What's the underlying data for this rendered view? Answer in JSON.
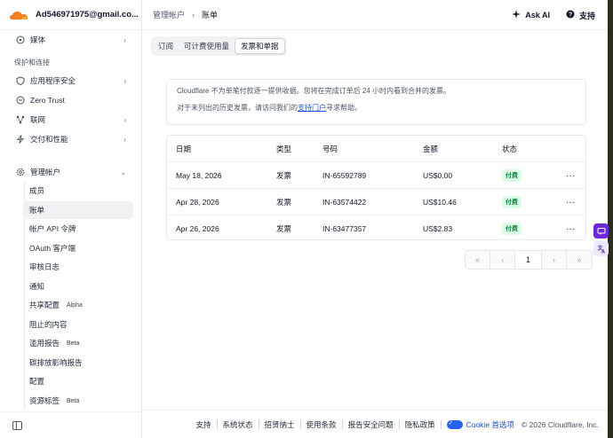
{
  "account": {
    "email": "Ad546971975@gmail.co..."
  },
  "sidebar": {
    "media_label": "媒体",
    "section_protect": "保护和连接",
    "items": [
      {
        "label": "应用程序安全",
        "icon": "shield-icon"
      },
      {
        "label": "Zero Trust",
        "icon": "zero-trust-icon"
      },
      {
        "label": "联网",
        "icon": "network-icon"
      },
      {
        "label": "交付和性能",
        "icon": "bolt-icon"
      }
    ],
    "manage_account": "管理帐户",
    "sub_items": [
      {
        "label": "成员"
      },
      {
        "label": "账单"
      },
      {
        "label": "帐户 API 令牌"
      },
      {
        "label": "OAuth 客户端"
      },
      {
        "label": "审核日志"
      },
      {
        "label": "通知"
      },
      {
        "label": "共享配置",
        "tag": "Alpha"
      },
      {
        "label": "阻止的内容"
      },
      {
        "label": "滥用报告",
        "tag": "Beta"
      },
      {
        "label": "碳排放影响报告"
      },
      {
        "label": "配置"
      },
      {
        "label": "资源标签",
        "tag": "Beta"
      }
    ]
  },
  "breadcrumb": {
    "parent": "管理帐户",
    "current": "账单"
  },
  "top_actions": {
    "ask_ai": "Ask AI",
    "support": "支持"
  },
  "tabs": [
    "订阅",
    "可计费使用量",
    "发票和单据"
  ],
  "notice": {
    "line1": "Cloudflare 不为单笔付款逐一提供收据。您将在完成订单后 24 小时内看到合并的发票。",
    "line2_prefix": "对于未列出的历史发票，请访问我们的",
    "line2_link": "支持门户",
    "line2_suffix": "寻求帮助。"
  },
  "table": {
    "headers": [
      "日期",
      "类型",
      "号码",
      "金额",
      "状态"
    ],
    "rows": [
      {
        "date": "May 18, 2026",
        "type": "发票",
        "number": "IN-65592789",
        "amount": "US$0.00",
        "status": "付费"
      },
      {
        "date": "Apr 28, 2026",
        "type": "发票",
        "number": "IN-63574422",
        "amount": "US$10.46",
        "status": "付费"
      },
      {
        "date": "Apr 26, 2026",
        "type": "发票",
        "number": "IN-63477357",
        "amount": "US$2.83",
        "status": "付费"
      }
    ],
    "more_label": "···"
  },
  "pagination": {
    "current_page": "1",
    "first": "«",
    "prev": "‹",
    "next": "›",
    "last": "»"
  },
  "footer": {
    "links": [
      "支持",
      "系统状态",
      "招贤纳士",
      "使用条款",
      "报告安全问题",
      "隐私政策"
    ],
    "cookie": "Cookie 首选项",
    "copyright": "© 2026 Cloudflare, Inc."
  },
  "colors": {
    "accent": "#f38020",
    "link": "#1d4ed8",
    "paid_badge_bg": "#dcfce7",
    "paid_badge_text": "#15803d",
    "widget": "#6d28d9"
  }
}
